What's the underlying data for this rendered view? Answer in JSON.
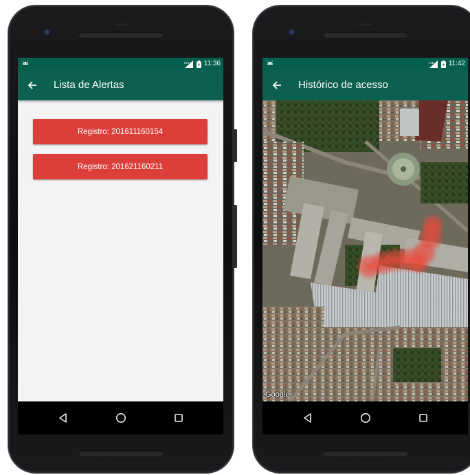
{
  "left_phone": {
    "status": {
      "time": "11:36"
    },
    "toolbar": {
      "title": "Lista de Alertas"
    },
    "alerts": [
      {
        "label": "Registro: 201611160154"
      },
      {
        "label": "Registro: 201621160211"
      }
    ]
  },
  "right_phone": {
    "status": {
      "time": "11:42"
    },
    "toolbar": {
      "title": "Histórico de acesso"
    },
    "map": {
      "attribution": "Google"
    }
  },
  "colors": {
    "status_bar": "#055f4f",
    "toolbar": "#0b604f",
    "alert_button": "#dc3f3a",
    "screen_background": "#f3f3f3",
    "heatmap": "#e8483a"
  },
  "icons": {
    "back": "arrow-left-icon",
    "nav_back": "triangle-back-icon",
    "nav_home": "circle-home-icon",
    "nav_recent": "square-recent-icon",
    "status": [
      "android-notification-icon",
      "lte-signal-icon",
      "battery-icon"
    ]
  }
}
